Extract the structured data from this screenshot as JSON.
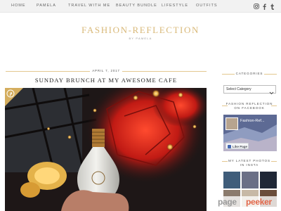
{
  "nav": {
    "items": [
      "HOME",
      "PAMELA",
      "TRAVEL WITH ME",
      "BEAUTY BUNDLE",
      "LIFESTYLE",
      "OUTFITS"
    ],
    "social_icons": [
      "instagram-icon",
      "facebook-icon",
      "tumblr-icon"
    ]
  },
  "header": {
    "title": "FASHION-REFLECTION",
    "byline": "BY PAMELA"
  },
  "post": {
    "date": "APRIL 7, 2017",
    "title": "SUNDAY BRUNCH AT MY AWESOME CAFE",
    "pin_icon": "pinterest-icon"
  },
  "sidebar": {
    "categories_heading": "CATEGORIES",
    "select_value": "Select Category",
    "facebook_heading": [
      "FASHION REFLECTION",
      "ON FACEBOOK"
    ],
    "facebook_page_name": "Fashion-Ref...",
    "like_button": "Like Page",
    "insta_heading": "MY LATEST PHOTOS IN INSTA"
  },
  "watermark": {
    "part1": "page",
    "part2": "peeker"
  },
  "colors": {
    "accent_gold": "#d9b979",
    "nav_bg": "#f2f2f2",
    "facebook_blue": "#4267b2",
    "watermark_orange": "#e2674a"
  }
}
